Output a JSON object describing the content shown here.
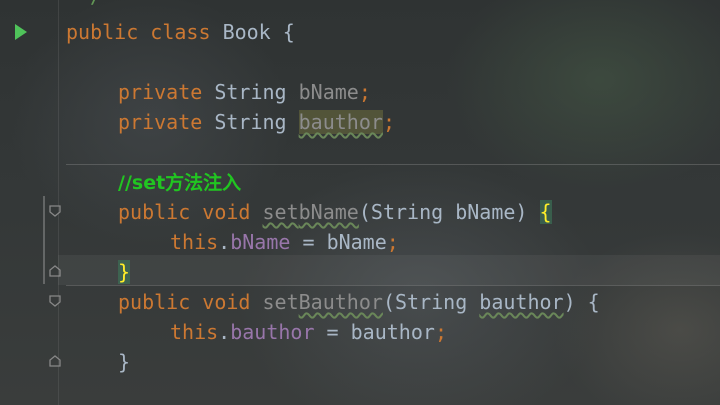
{
  "code": {
    "top_fragment": "*/",
    "class_line": {
      "kw1": "public",
      "kw2": "class",
      "name": "Book",
      "brace": "{"
    },
    "field1": {
      "modifier": "private",
      "type": "String",
      "name": "bName",
      "semi": ";"
    },
    "field2": {
      "modifier": "private",
      "type": "String",
      "name": "bauthor",
      "semi": ";"
    },
    "comment": "//set方法注入",
    "method1": {
      "kw1": "public",
      "kw2": "void",
      "name_prefix": "set",
      "name_rest": "bName",
      "open_paren": "(",
      "param_type": "String",
      "param_name": "bName",
      "close_paren": ")",
      "brace": "{"
    },
    "assign1": {
      "this": "this",
      "dot": ".",
      "field": "bName",
      "op": " = ",
      "value": "bName",
      "semi": ";"
    },
    "close1": "}",
    "method2": {
      "kw1": "public",
      "kw2": "void",
      "name_prefix": "set",
      "name_rest": "Bauthor",
      "open_paren": "(",
      "param_type": "String",
      "param_name": "bauthor",
      "close_paren": ")",
      "brace": "{"
    },
    "assign2": {
      "this": "this",
      "dot": ".",
      "field": "bauthor",
      "op": " = ",
      "value": "bauthor",
      "semi": ";"
    },
    "close2": "}"
  },
  "colors": {
    "keyword": "#cc7832",
    "field": "#9876aa",
    "comment": "#21c521",
    "text": "#a9b7c6",
    "run_icon": "#4fc35a"
  },
  "icons": [
    "run-gutter-icon",
    "fold-icon"
  ]
}
